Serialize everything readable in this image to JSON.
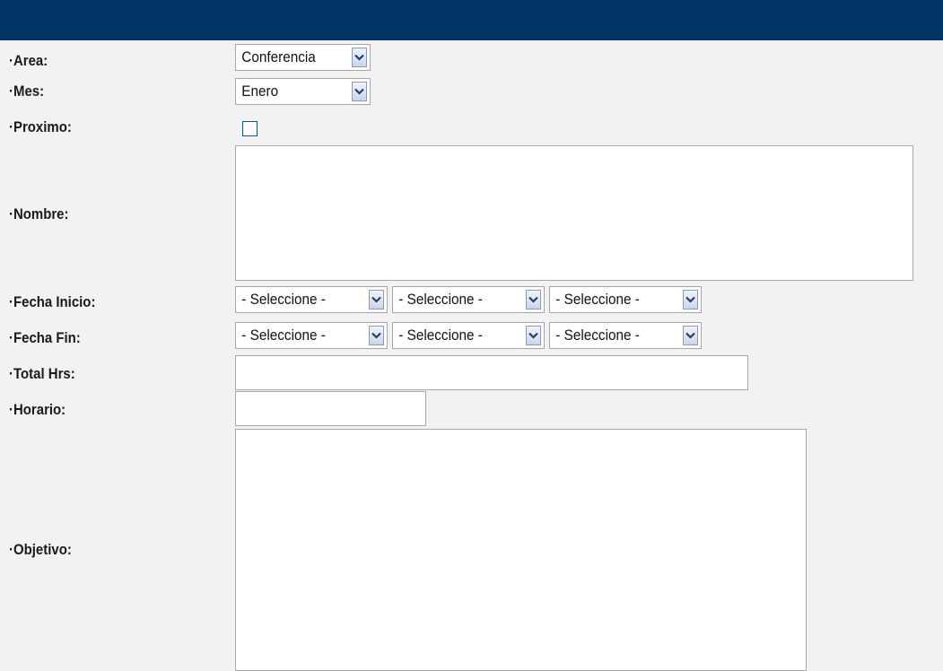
{
  "form": {
    "area": {
      "label": "·Area:",
      "value": "Conferencia"
    },
    "mes": {
      "label": "·Mes:",
      "value": "Enero"
    },
    "proximo": {
      "label": "·Proximo:",
      "checked": false
    },
    "nombre": {
      "label": "·Nombre:",
      "value": ""
    },
    "fecha_inicio": {
      "label": "·Fecha Inicio:",
      "day": "- Seleccione -",
      "month": "- Seleccione -",
      "year": "- Seleccione -"
    },
    "fecha_fin": {
      "label": "·Fecha Fin:",
      "day": "- Seleccione -",
      "month": "- Seleccione -",
      "year": "- Seleccione -"
    },
    "total_hrs": {
      "label": "·Total Hrs:",
      "value": ""
    },
    "horario": {
      "label": "·Horario:",
      "value": ""
    },
    "objetivo": {
      "label": "·Objetivo:",
      "value": ""
    }
  },
  "icons": {
    "dropdown": "chevron-down-icon"
  },
  "colors": {
    "header": "#003366",
    "background": "#f2f2f2",
    "field_border": "#a7a6aa",
    "checkbox_border": "#1c5180"
  }
}
